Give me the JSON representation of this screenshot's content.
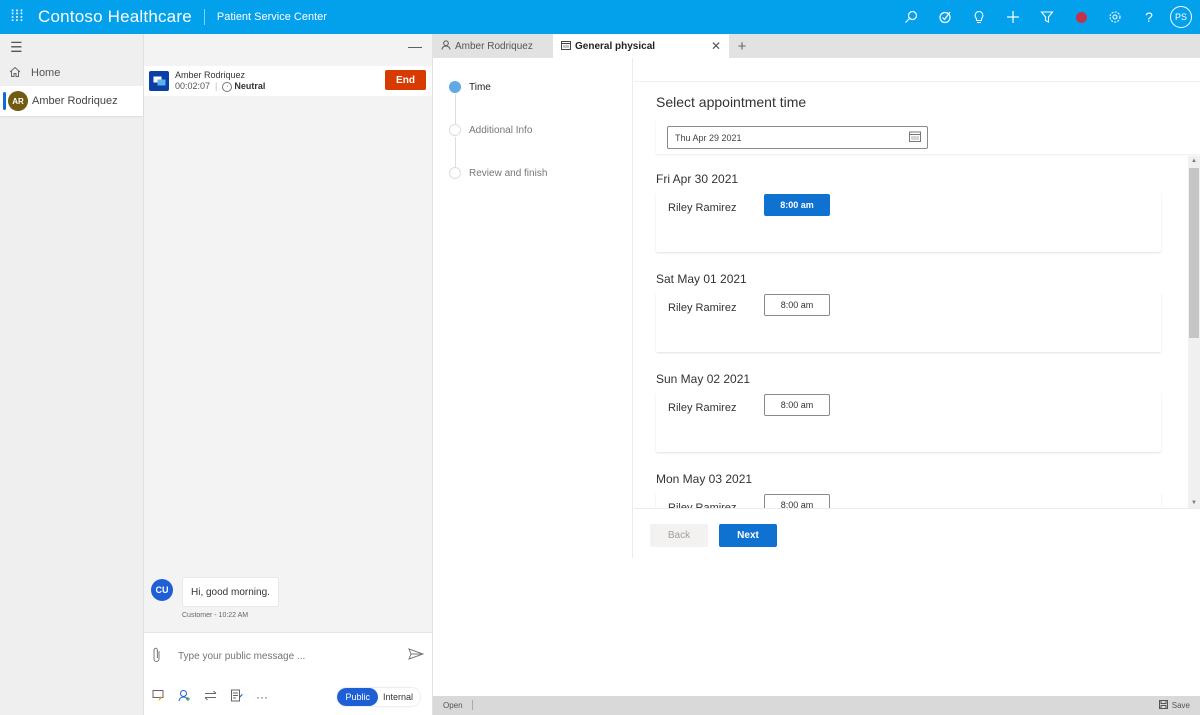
{
  "topbar": {
    "app_title": "Contoso Healthcare",
    "subtitle": "Patient Service Center",
    "user_initials": "PS",
    "presence_color": "#c4314b",
    "brand_color": "#03a1ec",
    "icons": [
      "search-icon",
      "task-icon",
      "lightbulb-icon",
      "plus-icon",
      "filter-icon",
      "presence-status",
      "gear-icon",
      "help-icon",
      "user-avatar"
    ]
  },
  "leftnav": {
    "home_label": "Home",
    "session": {
      "initials": "AR",
      "name": "Amber Rodriquez"
    }
  },
  "conversation": {
    "customer_name": "Amber Rodriquez",
    "duration": "00:02:07",
    "sentiment": "Neutral",
    "end_label": "End",
    "messages": [
      {
        "initials": "CU",
        "text": "Hi, good morning.",
        "meta": "Customer - 10:22 AM"
      }
    ],
    "compose_placeholder": "Type your public message ...",
    "mode_public": "Public",
    "mode_internal": "Internal",
    "more_label": "···"
  },
  "tabs": [
    {
      "label": "Amber Rodriquez",
      "icon": "person-icon"
    },
    {
      "label": "General physical",
      "icon": "calendar-icon",
      "active": true
    }
  ],
  "wizard": {
    "steps": [
      {
        "label": "Time",
        "active": true
      },
      {
        "label": "Additional Info",
        "active": false
      },
      {
        "label": "Review and finish",
        "active": false
      }
    ],
    "title": "Select appointment time",
    "date_value": "Thu Apr 29 2021",
    "days": [
      {
        "date": "Fri Apr 30 2021",
        "provider": "Riley Ramirez",
        "slot": "8:00 am",
        "selected": true
      },
      {
        "date": "Sat May 01 2021",
        "provider": "Riley Ramirez",
        "slot": "8:00 am",
        "selected": false
      },
      {
        "date": "Sun May 02 2021",
        "provider": "Riley Ramirez",
        "slot": "8:00 am",
        "selected": false
      },
      {
        "date": "Mon May 03 2021",
        "provider": "Riley Ramirez",
        "slot": "8:00 am",
        "selected": false
      }
    ],
    "back_label": "Back",
    "next_label": "Next"
  },
  "statusbar": {
    "status": "Open",
    "save_label": "Save"
  }
}
